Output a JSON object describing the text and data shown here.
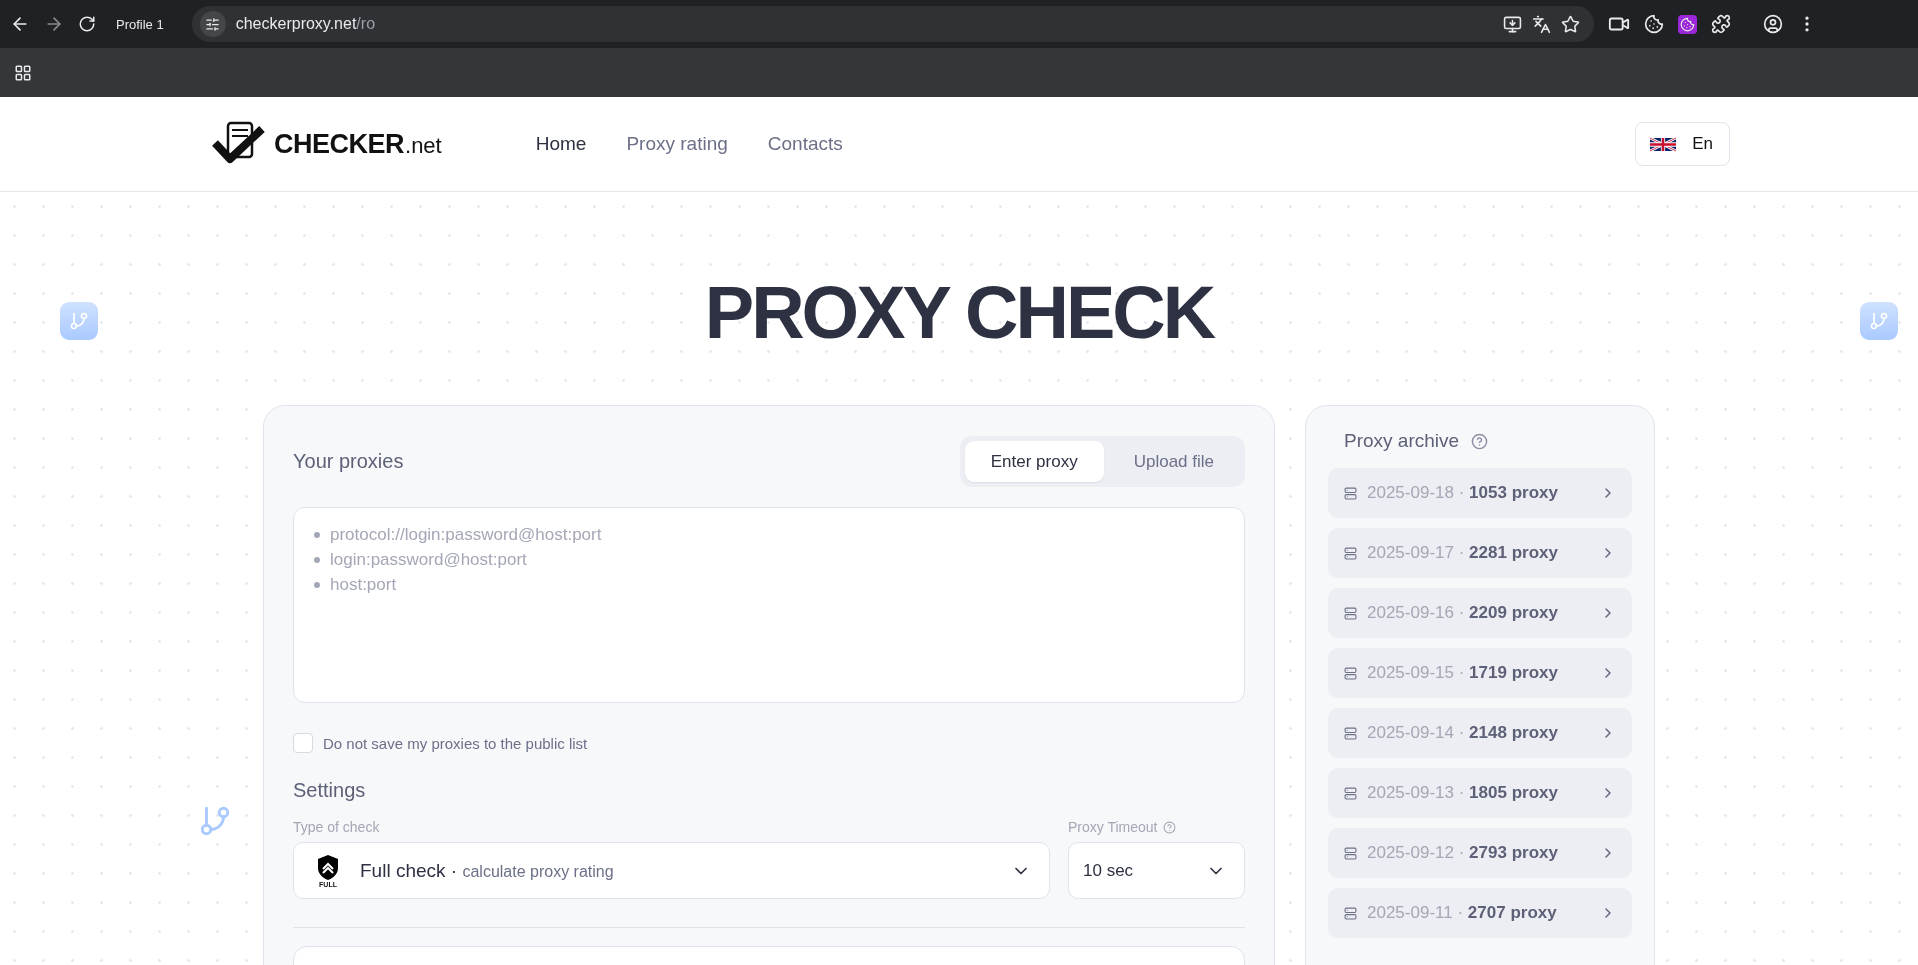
{
  "browser": {
    "profile": "Profile 1",
    "url_host": "checkerproxy.net",
    "url_path": "/ro"
  },
  "header": {
    "logo_main": "CHECKER",
    "logo_suffix": ".net",
    "nav": [
      {
        "label": "Home",
        "selected": true
      },
      {
        "label": "Proxy rating",
        "selected": false
      },
      {
        "label": "Contacts",
        "selected": false
      }
    ],
    "language": "En"
  },
  "title": "PROXY CHECK",
  "proxies": {
    "heading": "Your proxies",
    "tabs": [
      {
        "label": "Enter proxy",
        "selected": true
      },
      {
        "label": "Upload file",
        "selected": false
      }
    ],
    "placeholder_lines": [
      "protocol://login:password@host:port",
      "login:password@host:port",
      "host:port"
    ],
    "private_option": {
      "label": "Do not save my proxies to the public list",
      "checked": false
    },
    "settings_heading": "Settings",
    "type_label": "Type of check",
    "type_badge": "FULL",
    "type_value": "Full check",
    "type_separator": "·",
    "type_note": "calculate proxy rating",
    "timeout_label": "Proxy Timeout",
    "timeout_value": "10 sec"
  },
  "archive": {
    "heading": "Proxy archive",
    "separator": "·",
    "items": [
      {
        "date": "2025-09-18",
        "count": "1053 proxy"
      },
      {
        "date": "2025-09-17",
        "count": "2281 proxy"
      },
      {
        "date": "2025-09-16",
        "count": "2209 proxy"
      },
      {
        "date": "2025-09-15",
        "count": "1719 proxy"
      },
      {
        "date": "2025-09-14",
        "count": "2148 proxy"
      },
      {
        "date": "2025-09-13",
        "count": "1805 proxy"
      },
      {
        "date": "2025-09-12",
        "count": "2793 proxy"
      },
      {
        "date": "2025-09-11",
        "count": "2707 proxy"
      }
    ]
  }
}
